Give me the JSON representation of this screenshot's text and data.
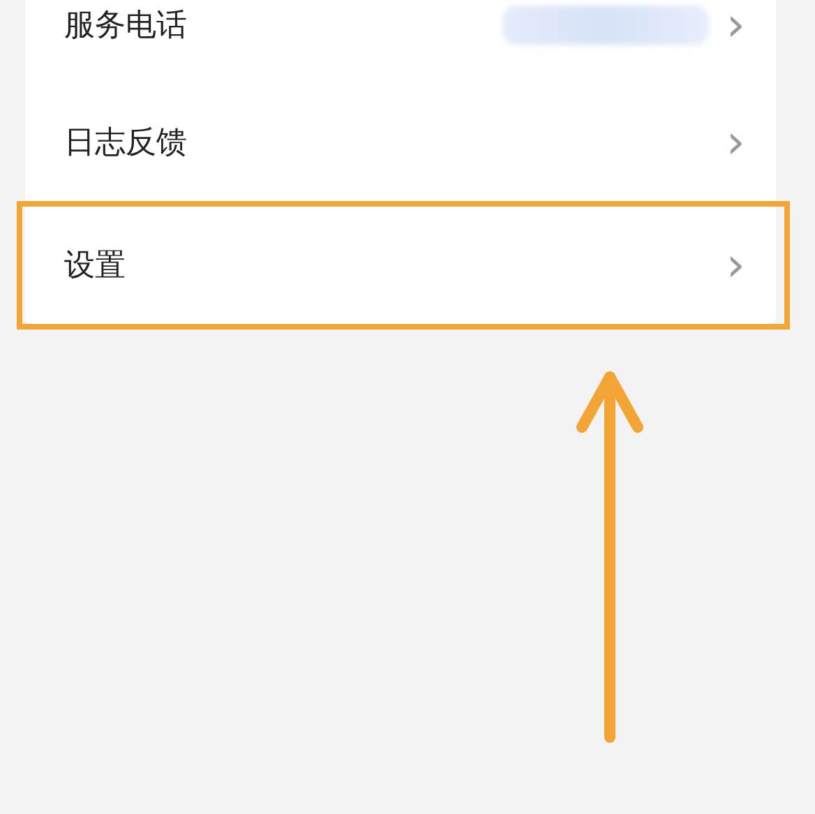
{
  "menu_items": [
    {
      "label": "服务电话",
      "kind": "redacted",
      "chevron": "›",
      "highlighted": false
    },
    {
      "label": "日志反馈",
      "kind": "plain",
      "chevron": "›",
      "highlighted": false
    },
    {
      "label": "设置",
      "kind": "plain",
      "chevron": "›",
      "highlighted": true
    }
  ]
}
